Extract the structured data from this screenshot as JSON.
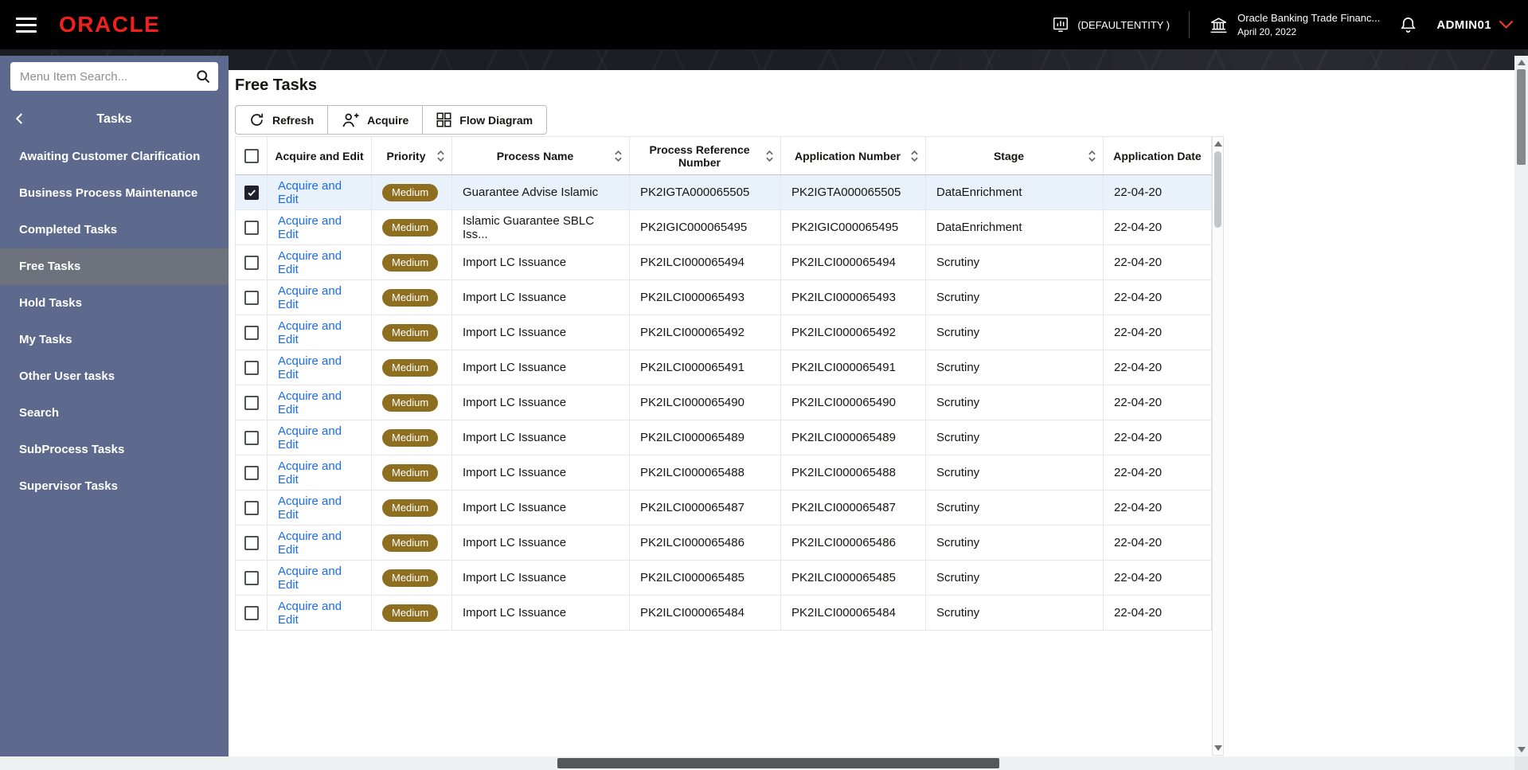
{
  "header": {
    "logo": "ORACLE",
    "entity_label": "(DEFAULTENTITY )",
    "app_title": "Oracle Banking Trade Financ...",
    "app_date": "April 20, 2022",
    "username": "ADMIN01"
  },
  "sidebar": {
    "search_placeholder": "Menu Item Search...",
    "section_title": "Tasks",
    "items": [
      {
        "label": "Awaiting Customer Clarification",
        "active": false
      },
      {
        "label": "Business Process Maintenance",
        "active": false
      },
      {
        "label": "Completed Tasks",
        "active": false
      },
      {
        "label": "Free Tasks",
        "active": true
      },
      {
        "label": "Hold Tasks",
        "active": false
      },
      {
        "label": "My Tasks",
        "active": false
      },
      {
        "label": "Other User tasks",
        "active": false
      },
      {
        "label": "Search",
        "active": false
      },
      {
        "label": "SubProcess Tasks",
        "active": false
      },
      {
        "label": "Supervisor Tasks",
        "active": false
      }
    ]
  },
  "main": {
    "title": "Free Tasks",
    "toolbar": {
      "refresh_label": "Refresh",
      "acquire_label": "Acquire",
      "flow_diagram_label": "Flow Diagram"
    },
    "table": {
      "columns": [
        {
          "label": "Acquire and Edit",
          "sortable": false
        },
        {
          "label": "Priority",
          "sortable": true
        },
        {
          "label": "Process Name",
          "sortable": true
        },
        {
          "label": "Process Reference Number",
          "sortable": true
        },
        {
          "label": "Application Number",
          "sortable": true
        },
        {
          "label": "Stage",
          "sortable": true
        },
        {
          "label": "Application Date",
          "sortable": false
        }
      ],
      "rows": [
        {
          "selected": true,
          "action": "Acquire and Edit",
          "priority": "Medium",
          "process_name": "Guarantee Advise Islamic",
          "process_reference_number": "PK2IGTA000065505",
          "application_number": "PK2IGTA000065505",
          "stage": "DataEnrichment",
          "application_date": "22-04-20"
        },
        {
          "selected": false,
          "action": "Acquire and Edit",
          "priority": "Medium",
          "process_name": "Islamic Guarantee SBLC Iss...",
          "process_reference_number": "PK2IGIC000065495",
          "application_number": "PK2IGIC000065495",
          "stage": "DataEnrichment",
          "application_date": "22-04-20"
        },
        {
          "selected": false,
          "action": "Acquire and Edit",
          "priority": "Medium",
          "process_name": "Import LC Issuance",
          "process_reference_number": "PK2ILCI000065494",
          "application_number": "PK2ILCI000065494",
          "stage": "Scrutiny",
          "application_date": "22-04-20"
        },
        {
          "selected": false,
          "action": "Acquire and Edit",
          "priority": "Medium",
          "process_name": "Import LC Issuance",
          "process_reference_number": "PK2ILCI000065493",
          "application_number": "PK2ILCI000065493",
          "stage": "Scrutiny",
          "application_date": "22-04-20"
        },
        {
          "selected": false,
          "action": "Acquire and Edit",
          "priority": "Medium",
          "process_name": "Import LC Issuance",
          "process_reference_number": "PK2ILCI000065492",
          "application_number": "PK2ILCI000065492",
          "stage": "Scrutiny",
          "application_date": "22-04-20"
        },
        {
          "selected": false,
          "action": "Acquire and Edit",
          "priority": "Medium",
          "process_name": "Import LC Issuance",
          "process_reference_number": "PK2ILCI000065491",
          "application_number": "PK2ILCI000065491",
          "stage": "Scrutiny",
          "application_date": "22-04-20"
        },
        {
          "selected": false,
          "action": "Acquire and Edit",
          "priority": "Medium",
          "process_name": "Import LC Issuance",
          "process_reference_number": "PK2ILCI000065490",
          "application_number": "PK2ILCI000065490",
          "stage": "Scrutiny",
          "application_date": "22-04-20"
        },
        {
          "selected": false,
          "action": "Acquire and Edit",
          "priority": "Medium",
          "process_name": "Import LC Issuance",
          "process_reference_number": "PK2ILCI000065489",
          "application_number": "PK2ILCI000065489",
          "stage": "Scrutiny",
          "application_date": "22-04-20"
        },
        {
          "selected": false,
          "action": "Acquire and Edit",
          "priority": "Medium",
          "process_name": "Import LC Issuance",
          "process_reference_number": "PK2ILCI000065488",
          "application_number": "PK2ILCI000065488",
          "stage": "Scrutiny",
          "application_date": "22-04-20"
        },
        {
          "selected": false,
          "action": "Acquire and Edit",
          "priority": "Medium",
          "process_name": "Import LC Issuance",
          "process_reference_number": "PK2ILCI000065487",
          "application_number": "PK2ILCI000065487",
          "stage": "Scrutiny",
          "application_date": "22-04-20"
        },
        {
          "selected": false,
          "action": "Acquire and Edit",
          "priority": "Medium",
          "process_name": "Import LC Issuance",
          "process_reference_number": "PK2ILCI000065486",
          "application_number": "PK2ILCI000065486",
          "stage": "Scrutiny",
          "application_date": "22-04-20"
        },
        {
          "selected": false,
          "action": "Acquire and Edit",
          "priority": "Medium",
          "process_name": "Import LC Issuance",
          "process_reference_number": "PK2ILCI000065485",
          "application_number": "PK2ILCI000065485",
          "stage": "Scrutiny",
          "application_date": "22-04-20"
        },
        {
          "selected": false,
          "action": "Acquire and Edit",
          "priority": "Medium",
          "process_name": "Import LC Issuance",
          "process_reference_number": "PK2ILCI000065484",
          "application_number": "PK2ILCI000065484",
          "stage": "Scrutiny",
          "application_date": "22-04-20"
        }
      ]
    }
  },
  "colors": {
    "brand_red": "#f0201e",
    "link_blue": "#1a6be5",
    "priority_medium_bg": "#8d6f1f",
    "sidebar_bg": "#5e6a8d",
    "sidebar_active_bg": "#6d727c",
    "selected_row_bg": "#e9f2fb",
    "header_bg": "#000000"
  }
}
